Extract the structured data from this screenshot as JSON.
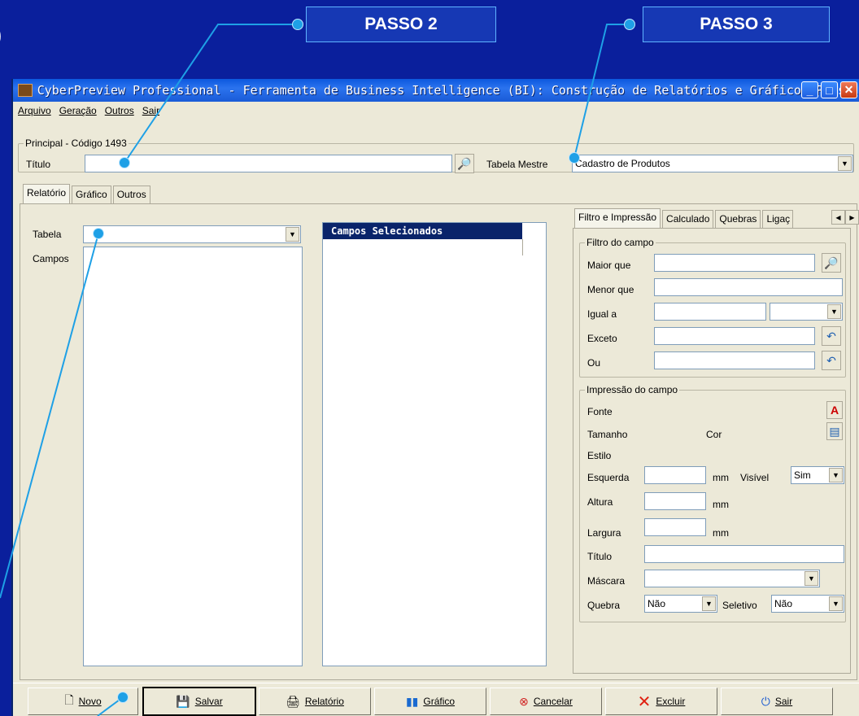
{
  "slide": {
    "edge_char": ")",
    "step2_label": "PASSO 2",
    "step3_label": "PASSO 3",
    "accent_color": "#1ea0e6",
    "background_color": "#0a1f9c"
  },
  "window": {
    "title": "CyberPreview Professional - Ferramenta de Business Intelligence (BI): Construção de Relatórios e Gráficos Perso...",
    "menu": [
      "Arquivo",
      "Geração",
      "Outros",
      "Sair"
    ]
  },
  "principal": {
    "group_title": "Principal - Código 1493",
    "titulo_label": "Título",
    "titulo_value": "",
    "tabela_mestre_label": "Tabela Mestre",
    "tabela_mestre_value": "Cadastro de Produtos"
  },
  "main_tabs": [
    "Relatório",
    "Gráfico",
    "Outros"
  ],
  "left": {
    "tabela_label": "Tabela",
    "tabela_value": "",
    "campos_label": "Campos",
    "selecionados_header": "Campos Selecionados"
  },
  "right_tabs": [
    "Filtro e Impressão",
    "Calculado",
    "Quebras",
    "Ligaç"
  ],
  "filtro": {
    "group_title": "Filtro do campo",
    "maior_que": "Maior que",
    "menor_que": "Menor que",
    "igual_a": "Igual a",
    "exceto": "Exceto",
    "ou": "Ou"
  },
  "impressao": {
    "group_title": "Impressão do campo",
    "fonte": "Fonte",
    "tamanho": "Tamanho",
    "cor": "Cor",
    "estilo": "Estilo",
    "esquerda": "Esquerda",
    "mm": "mm",
    "visivel_label": "Visível",
    "visivel_value": "Sim",
    "altura": "Altura",
    "largura": "Largura",
    "titulo": "Título",
    "mascara": "Máscara",
    "quebra_label": "Quebra",
    "quebra_value": "Não",
    "seletivo_label": "Seletivo",
    "seletivo_value": "Não"
  },
  "buttons": {
    "novo": "Novo",
    "salvar": "Salvar",
    "relatorio": "Relatório",
    "grafico": "Gráfico",
    "cancelar": "Cancelar",
    "excluir": "Excluir",
    "sair": "Sair"
  }
}
